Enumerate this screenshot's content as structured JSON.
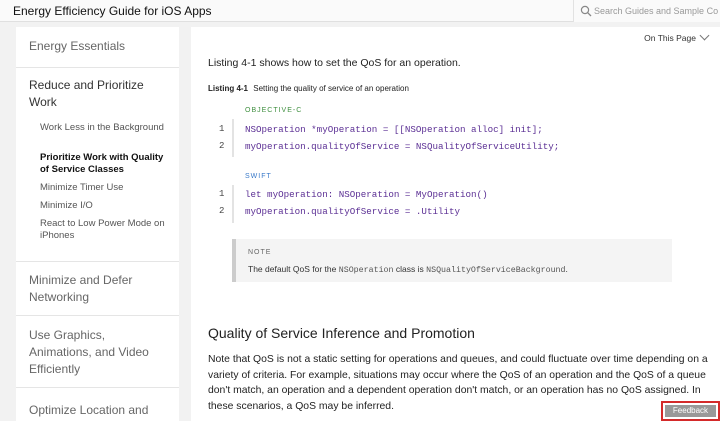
{
  "header": {
    "title": "Energy Efficiency Guide for iOS Apps",
    "search_placeholder": "Search Guides and Sample Code"
  },
  "sidebar": {
    "sections": [
      {
        "label": "Energy Essentials"
      },
      {
        "label": "Reduce and Prioritize Work",
        "items": [
          {
            "label": "Work Less in the Background"
          },
          {
            "label": "Prioritize Work with Quality of Service Classes"
          },
          {
            "label": "Minimize Timer Use"
          },
          {
            "label": "Minimize I/O"
          },
          {
            "label": "React to Low Power Mode on iPhones"
          }
        ]
      },
      {
        "label": "Minimize and Defer Networking"
      },
      {
        "label": "Use Graphics, Animations, and Video Efficiently"
      },
      {
        "label": "Optimize Location and"
      }
    ]
  },
  "main": {
    "on_this_page": "On This Page",
    "intro": "Listing 4-1 shows how to set the QoS for an operation.",
    "caption_num": "Listing 4-1",
    "caption_text": "Setting the quality of service of an operation",
    "objc_label": "OBJECTIVE-C",
    "objc_lines": [
      {
        "n": "1",
        "code": "NSOperation *myOperation = [[NSOperation alloc] init];"
      },
      {
        "n": "2",
        "code": "myOperation.qualityOfService = NSQualityOfServiceUtility;"
      }
    ],
    "swift_label": "SWIFT",
    "swift_lines": [
      {
        "n": "1",
        "code": "let myOperation: NSOperation = MyOperation()"
      },
      {
        "n": "2",
        "code": "myOperation.qualityOfService = .Utility"
      }
    ],
    "note_label": "NOTE",
    "note_pre": "The default QoS for the ",
    "note_class": "NSOperation",
    "note_mid": " class is ",
    "note_value": "NSQualityOfServiceBackground",
    "note_post": ".",
    "section_heading": "Quality of Service Inference and Promotion",
    "section_body": "Note that QoS is not a static setting for operations and queues, and could fluctuate over time depending on a variety of criteria. For example, situations may occur where the QoS of an operation and the QoS of a queue don't match, an operation and a dependent operation don't match, or an operation has no QoS assigned. In these scenarios, a QoS may be inferred."
  },
  "feedback": {
    "label": "Feedback"
  },
  "colors": {
    "accent_objc": "#3f8f3f",
    "accent_swift": "#3a7ac9",
    "feedback_border": "#d42a2a"
  }
}
